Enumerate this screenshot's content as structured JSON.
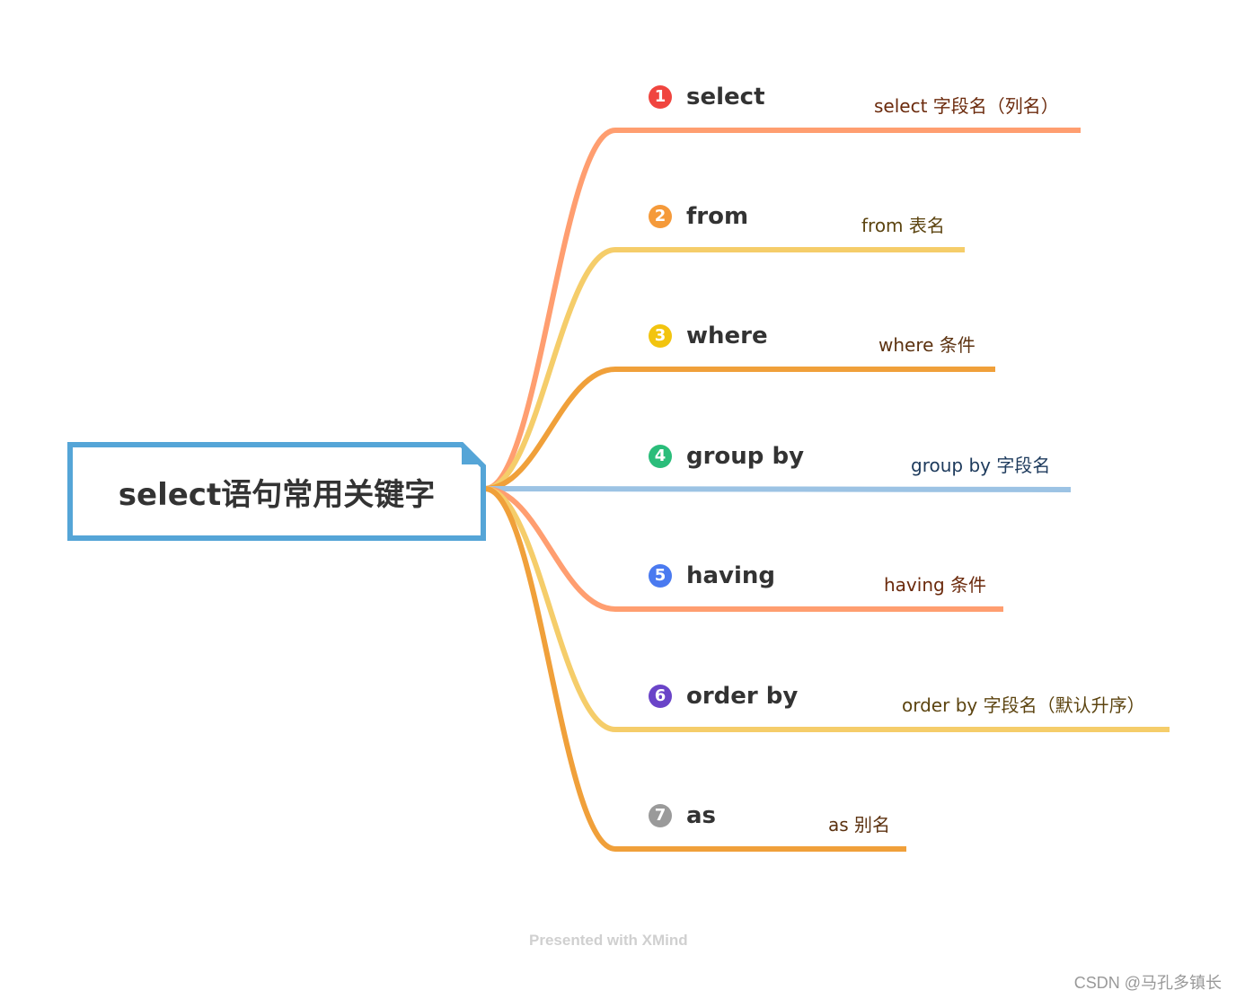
{
  "root": {
    "title": "select语句常用关键字",
    "border_color": "#55a5d7"
  },
  "topics": [
    {
      "num": "1",
      "label": "select",
      "detail": "select 字段名（列名）",
      "line_color": "#ff9e70",
      "badge_color": "#f0453f",
      "detail_color": "#6b2a0c"
    },
    {
      "num": "2",
      "label": "from",
      "detail": "from 表名",
      "line_color": "#f5cd6a",
      "badge_color": "#f59a3a",
      "detail_color": "#5c4410"
    },
    {
      "num": "3",
      "label": "where",
      "detail": "where 条件",
      "line_color": "#f0a03a",
      "badge_color": "#f2c40f",
      "detail_color": "#5c3210"
    },
    {
      "num": "4",
      "label": "group by",
      "detail": "group by 字段名",
      "line_color": "#9cc3e4",
      "badge_color": "#2abd7a",
      "detail_color": "#1d3a5c"
    },
    {
      "num": "5",
      "label": "having",
      "detail": "having 条件",
      "line_color": "#ff9e70",
      "badge_color": "#4a7af0",
      "detail_color": "#6b2a0c"
    },
    {
      "num": "6",
      "label": "order by",
      "detail": "order by 字段名（默认升序）",
      "line_color": "#f5cd6a",
      "badge_color": "#6a44c8",
      "detail_color": "#5c4410"
    },
    {
      "num": "7",
      "label": "as",
      "detail": "as 别名",
      "line_color": "#f0a03a",
      "badge_color": "#9a9a9a",
      "detail_color": "#5c3210"
    }
  ],
  "footer": {
    "watermark": "Presented with XMind",
    "credit": "CSDN @马孔多镇长"
  }
}
